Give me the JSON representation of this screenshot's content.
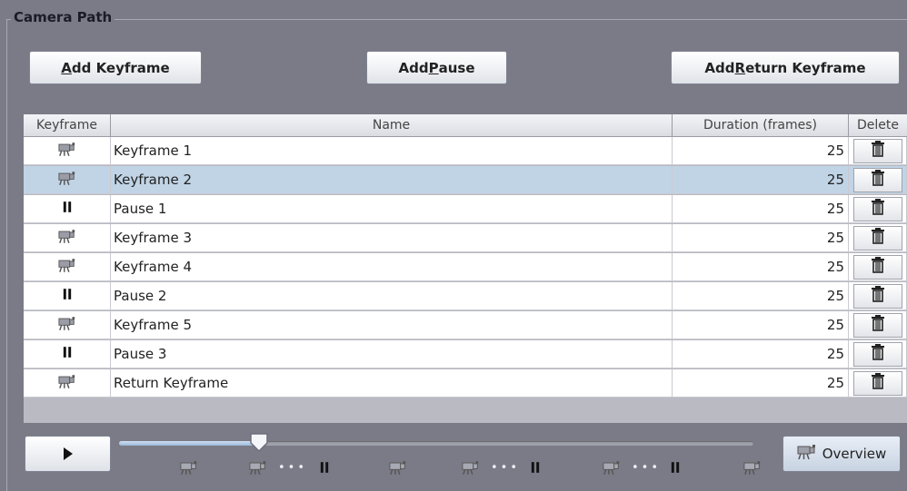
{
  "panel": {
    "title": "Camera Path"
  },
  "buttons": {
    "add_keyframe_pre": "",
    "add_keyframe_mn": "A",
    "add_keyframe_post": "dd Keyframe",
    "add_pause_pre": "Add ",
    "add_pause_mn": "P",
    "add_pause_post": "ause",
    "add_return_pre": "Add ",
    "add_return_mn": "R",
    "add_return_post": "eturn Keyframe"
  },
  "table": {
    "columns": [
      "Keyframe",
      "Name",
      "Duration (frames)",
      "Delete"
    ],
    "rows": [
      {
        "type": "keyframe",
        "name": "Keyframe 1",
        "duration": "25",
        "selected": false
      },
      {
        "type": "keyframe",
        "name": "Keyframe 2",
        "duration": "25",
        "selected": true
      },
      {
        "type": "pause",
        "name": "Pause 1",
        "duration": "25",
        "selected": false
      },
      {
        "type": "keyframe",
        "name": "Keyframe 3",
        "duration": "25",
        "selected": false
      },
      {
        "type": "keyframe",
        "name": "Keyframe 4",
        "duration": "25",
        "selected": false
      },
      {
        "type": "pause",
        "name": "Pause 2",
        "duration": "25",
        "selected": false
      },
      {
        "type": "keyframe",
        "name": "Keyframe 5",
        "duration": "25",
        "selected": false
      },
      {
        "type": "pause",
        "name": "Pause 3",
        "duration": "25",
        "selected": false
      },
      {
        "type": "keyframe",
        "name": "Return Keyframe",
        "duration": "25",
        "selected": false
      }
    ]
  },
  "timeline": {
    "progress": 0.22,
    "markers": [
      "camera-icon",
      "camera-icon",
      "pause-icon",
      "camera-icon",
      "camera-icon",
      "pause-icon",
      "camera-icon",
      "pause-icon",
      "camera-icon"
    ]
  },
  "overview": {
    "label": "Overview"
  },
  "colors": {
    "background": "#7a7b86",
    "selected_row": "#c0d4e6",
    "slider_fill": "#9ab8da"
  }
}
